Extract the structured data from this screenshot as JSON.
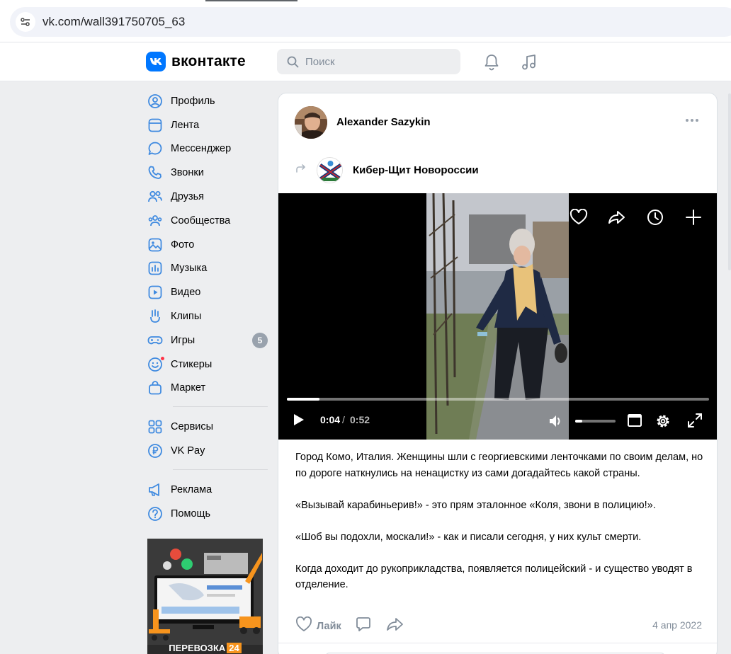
{
  "browser": {
    "url": "vk.com/wall391750705_63",
    "site_settings_icon": "tune-icon"
  },
  "header": {
    "logo_text": "вконтакте",
    "search_placeholder": "Поиск",
    "icons": [
      "bell-icon",
      "music-note-icon"
    ],
    "accent_color": "#0077ff"
  },
  "sidebar": {
    "groups": [
      [
        {
          "id": "profile",
          "label": "Профиль",
          "icon": "user-circle-icon"
        },
        {
          "id": "feed",
          "label": "Лента",
          "icon": "feed-icon"
        },
        {
          "id": "messenger",
          "label": "Мессенджер",
          "icon": "chat-bubble-icon"
        },
        {
          "id": "calls",
          "label": "Звонки",
          "icon": "phone-icon"
        },
        {
          "id": "friends",
          "label": "Друзья",
          "icon": "friends-icon"
        },
        {
          "id": "communities",
          "label": "Сообщества",
          "icon": "communities-icon"
        },
        {
          "id": "photos",
          "label": "Фото",
          "icon": "photo-icon"
        },
        {
          "id": "music",
          "label": "Музыка",
          "icon": "music-icon"
        },
        {
          "id": "video",
          "label": "Видео",
          "icon": "video-icon"
        },
        {
          "id": "clips",
          "label": "Клипы",
          "icon": "clips-icon"
        },
        {
          "id": "games",
          "label": "Игры",
          "icon": "gamepad-icon",
          "badge": "5"
        },
        {
          "id": "stickers",
          "label": "Стикеры",
          "icon": "smile-icon",
          "dot": true
        },
        {
          "id": "market",
          "label": "Маркет",
          "icon": "shopping-bag-icon"
        }
      ],
      [
        {
          "id": "services",
          "label": "Сервисы",
          "icon": "grid-icon"
        },
        {
          "id": "vkpay",
          "label": "VK Pay",
          "icon": "ruble-circle-icon"
        }
      ],
      [
        {
          "id": "ads",
          "label": "Реклама",
          "icon": "megaphone-icon"
        },
        {
          "id": "help",
          "label": "Помощь",
          "icon": "question-circle-icon"
        }
      ]
    ],
    "ad_banner": {
      "text": "ПЕРЕВОЗКА",
      "badge": "24"
    }
  },
  "post": {
    "author": "Alexander Sazykin",
    "source": "Кибер-Щит Новороссии",
    "video": {
      "time_current": "0:04",
      "time_separator": "/",
      "time_total": "0:52",
      "progress_fraction": 0.077,
      "volume_fraction": 0.18,
      "top_icons": [
        "heart-icon",
        "share-icon",
        "clock-icon",
        "plus-icon"
      ],
      "control_icons": [
        "play-icon",
        "volume-icon",
        "miniplayer-icon",
        "settings-icon",
        "fullscreen-icon"
      ]
    },
    "text": [
      "Город Комо, Италия. Женщины шли с георгиевскими ленточками по своим делам, но по дороге наткнулись на ненацистку из сами догадайтесь какой страны.",
      "«Вызывай карабиньерив!» - это прям эталонное «Коля, звони в полицию!».",
      "«Шоб вы подохли, москали!» - как и писали сегодня, у них культ смерти.",
      "Когда доходит до рукоприкладства, появляется полицейский - и существо уводят в отделение."
    ],
    "actions": {
      "like_label": "Лайк",
      "icons": [
        "heart-outline-icon",
        "comment-icon",
        "share-icon"
      ]
    },
    "date": "4 апр 2022"
  }
}
